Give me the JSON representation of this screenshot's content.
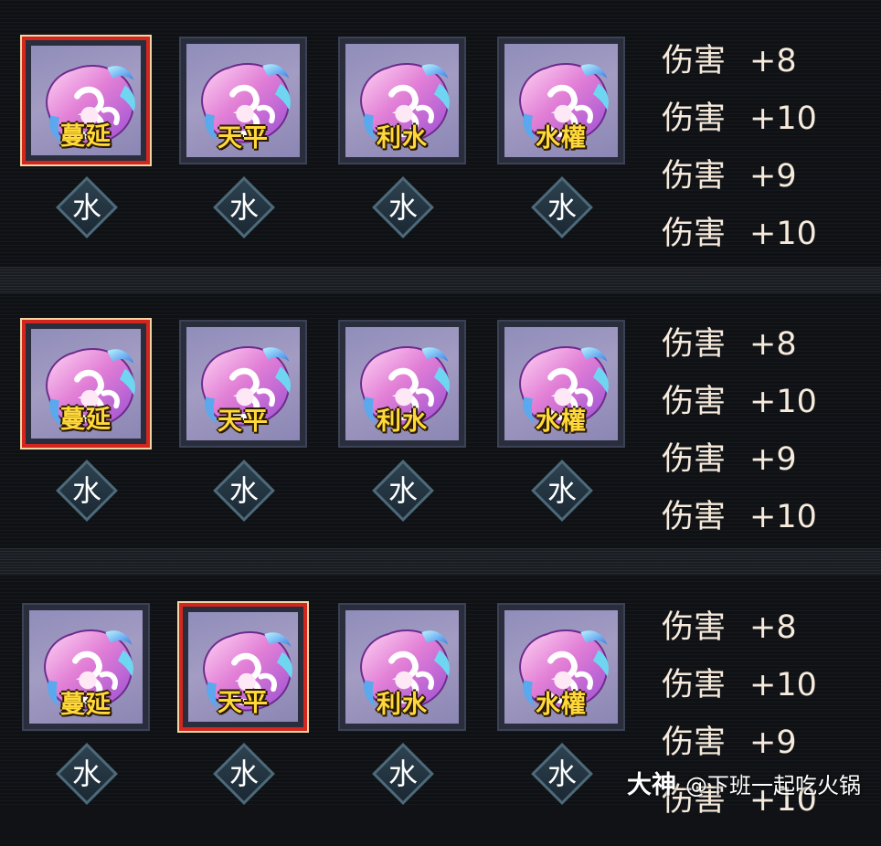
{
  "panels": [
    {
      "selected_index": 0,
      "gems": [
        {
          "name": "蔓延",
          "element": "水"
        },
        {
          "name": "天平",
          "element": "水"
        },
        {
          "name": "利水",
          "element": "水"
        },
        {
          "name": "水權",
          "element": "水"
        }
      ],
      "stats": [
        {
          "label": "伤害",
          "value": "+8"
        },
        {
          "label": "伤害",
          "value": "+10"
        },
        {
          "label": "伤害",
          "value": "+9"
        },
        {
          "label": "伤害",
          "value": "+10"
        }
      ]
    },
    {
      "selected_index": 0,
      "gems": [
        {
          "name": "蔓延",
          "element": "水"
        },
        {
          "name": "天平",
          "element": "水"
        },
        {
          "name": "利水",
          "element": "水"
        },
        {
          "name": "水權",
          "element": "水"
        }
      ],
      "stats": [
        {
          "label": "伤害",
          "value": "+8"
        },
        {
          "label": "伤害",
          "value": "+10"
        },
        {
          "label": "伤害",
          "value": "+9"
        },
        {
          "label": "伤害",
          "value": "+10"
        }
      ]
    },
    {
      "selected_index": 1,
      "gems": [
        {
          "name": "蔓延",
          "element": "水"
        },
        {
          "name": "天平",
          "element": "水"
        },
        {
          "name": "利水",
          "element": "水"
        },
        {
          "name": "水權",
          "element": "水"
        }
      ],
      "stats": [
        {
          "label": "伤害",
          "value": "+8"
        },
        {
          "label": "伤害",
          "value": "+10"
        },
        {
          "label": "伤害",
          "value": "+9"
        },
        {
          "label": "伤害",
          "value": "+10"
        }
      ]
    }
  ],
  "watermark": {
    "logo": "大神",
    "text": "@下班一起吃火锅"
  },
  "colors": {
    "selected_border": "#d3261f",
    "gem_label": "#ffd83a",
    "stat_text": "#f6eadc"
  }
}
